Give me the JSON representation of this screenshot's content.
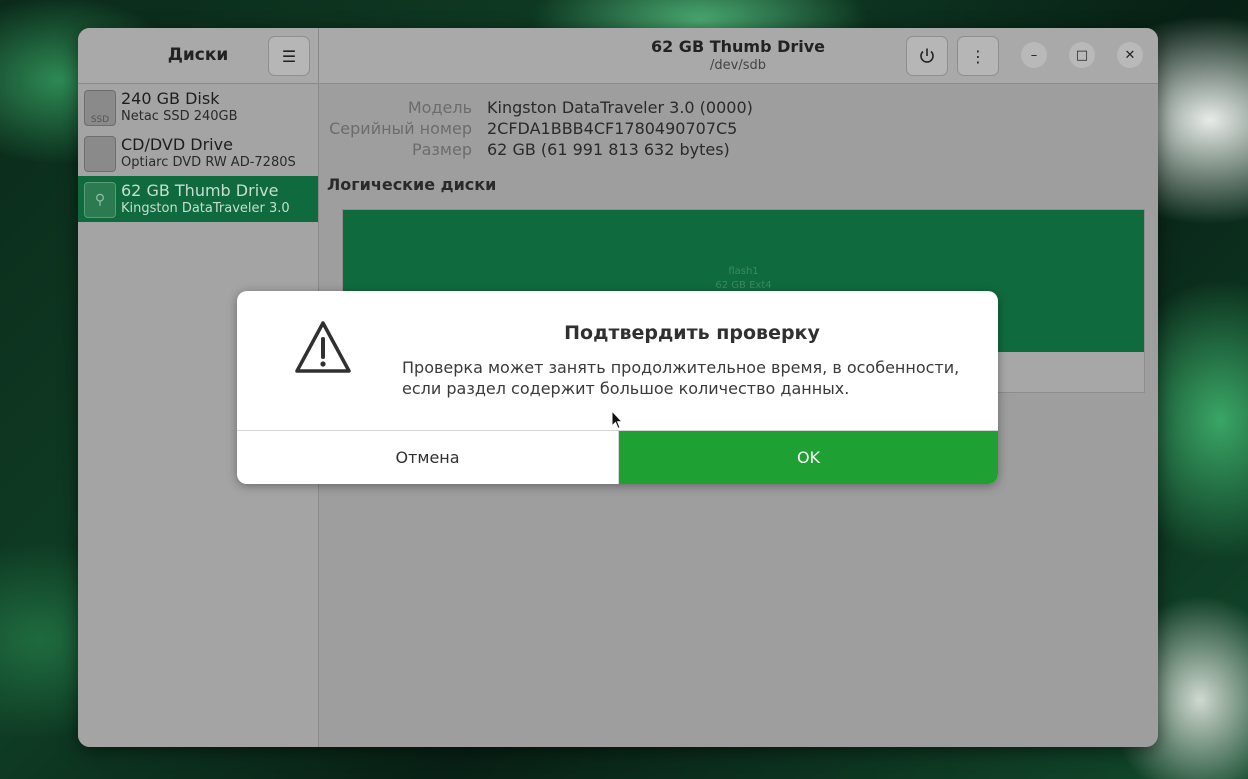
{
  "sidebar": {
    "title": "Диски",
    "menu_icon": "hamburger-icon",
    "drives": [
      {
        "name": "240 GB Disk",
        "sub": "Netac SSD 240GB",
        "icon": "ssd-icon",
        "icon_text": "SSD"
      },
      {
        "name": "CD/DVD Drive",
        "sub": "Optiarc DVD RW AD-7280S",
        "icon": "optical-drive-icon",
        "icon_text": ""
      },
      {
        "name": "62 GB Thumb Drive",
        "sub": "Kingston DataTraveler 3.0",
        "icon": "usb-icon",
        "icon_text": "⚲",
        "selected": true
      }
    ]
  },
  "header": {
    "title": "62 GB Thumb Drive",
    "subtitle": "/dev/sdb",
    "power_icon": "power-icon",
    "kebab_icon": "more-vertical-icon",
    "window_controls": [
      "minimize-icon",
      "maximize-icon",
      "close-icon"
    ]
  },
  "details": {
    "model_label": "Модель",
    "model_value": "Kingston DataTraveler 3.0 (0000)",
    "serial_label": "Серийный номер",
    "serial_value": "2CFDA1BBB4CF1780490707C5",
    "size_label": "Размер",
    "size_value": "62 GB (61 991 813 632 bytes)"
  },
  "volumes": {
    "title": "Логические диски",
    "partition_name": "flash1",
    "partition_size": "62 GB Ext4"
  },
  "dialog": {
    "icon": "warning-icon",
    "title": "Подтвердить проверку",
    "message": "Проверка может занять продолжительное время, в особенности, если раздел содержит большое количество данных.",
    "cancel_label": "Отмена",
    "ok_label": "OK"
  },
  "colors": {
    "accent": "#0f6b3d",
    "ok_button": "#1ea033"
  }
}
